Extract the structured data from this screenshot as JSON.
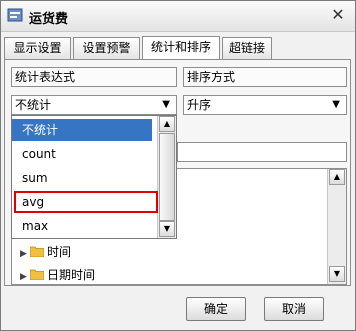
{
  "window": {
    "title": "运货费",
    "close_glyph": "✕"
  },
  "tabs": [
    {
      "label": "显示设置"
    },
    {
      "label": "设置预警"
    },
    {
      "label": "统计和排序",
      "active": true
    },
    {
      "label": "超链接"
    }
  ],
  "stats": {
    "expr_label": "统计表达式",
    "sort_label": "排序方式",
    "stat_selected": "不统计",
    "sort_selected": "升序"
  },
  "dropdown": {
    "options": [
      "不统计",
      "count",
      "sum",
      "avg",
      "max"
    ],
    "selected": "不统计",
    "highlighted": "avg"
  },
  "tree": {
    "items": [
      {
        "label": "时间"
      },
      {
        "label": "日期时间"
      }
    ]
  },
  "buttons": {
    "ok": "确定",
    "cancel": "取消"
  },
  "colors": {
    "selection": "#3575c4",
    "highlight_border": "#e00000",
    "folder": "#f0c040"
  }
}
